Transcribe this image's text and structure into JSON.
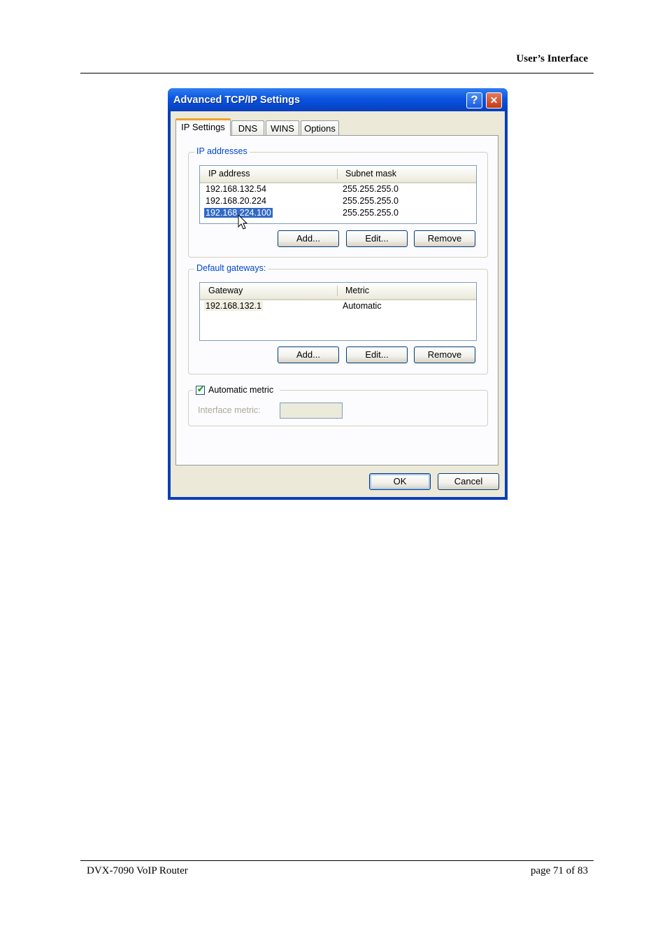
{
  "page": {
    "header_title": "User’s Interface",
    "footer_left": "DVX-7090 VoIP Router",
    "footer_right": "page 71 of 83"
  },
  "dialog": {
    "title": "Advanced TCP/IP Settings",
    "help_glyph": "?",
    "close_glyph": "✕",
    "tabs": [
      {
        "label": "IP Settings",
        "active": true
      },
      {
        "label": "DNS"
      },
      {
        "label": "WINS"
      },
      {
        "label": "Options"
      }
    ],
    "ip_addresses": {
      "legend": "IP addresses",
      "columns": [
        "IP address",
        "Subnet mask"
      ],
      "rows": [
        {
          "ip": "192.168.132.54",
          "mask": "255.255.255.0"
        },
        {
          "ip": "192.168.20.224",
          "mask": "255.255.255.0"
        },
        {
          "ip": "192.168.224.100",
          "mask": "255.255.255.0",
          "selected": true
        }
      ],
      "buttons": {
        "add": "Add...",
        "edit": "Edit...",
        "remove": "Remove"
      }
    },
    "gateways": {
      "legend": "Default gateways:",
      "columns": [
        "Gateway",
        "Metric"
      ],
      "rows": [
        {
          "gateway": "192.168.132.1",
          "metric": "Automatic"
        }
      ],
      "buttons": {
        "add": "Add...",
        "edit": "Edit...",
        "remove": "Remove"
      }
    },
    "automatic_metric": {
      "label": "Automatic metric",
      "checked": true
    },
    "interface_metric": {
      "label": "Interface metric:",
      "value": ""
    },
    "ok": "OK",
    "cancel": "Cancel"
  }
}
